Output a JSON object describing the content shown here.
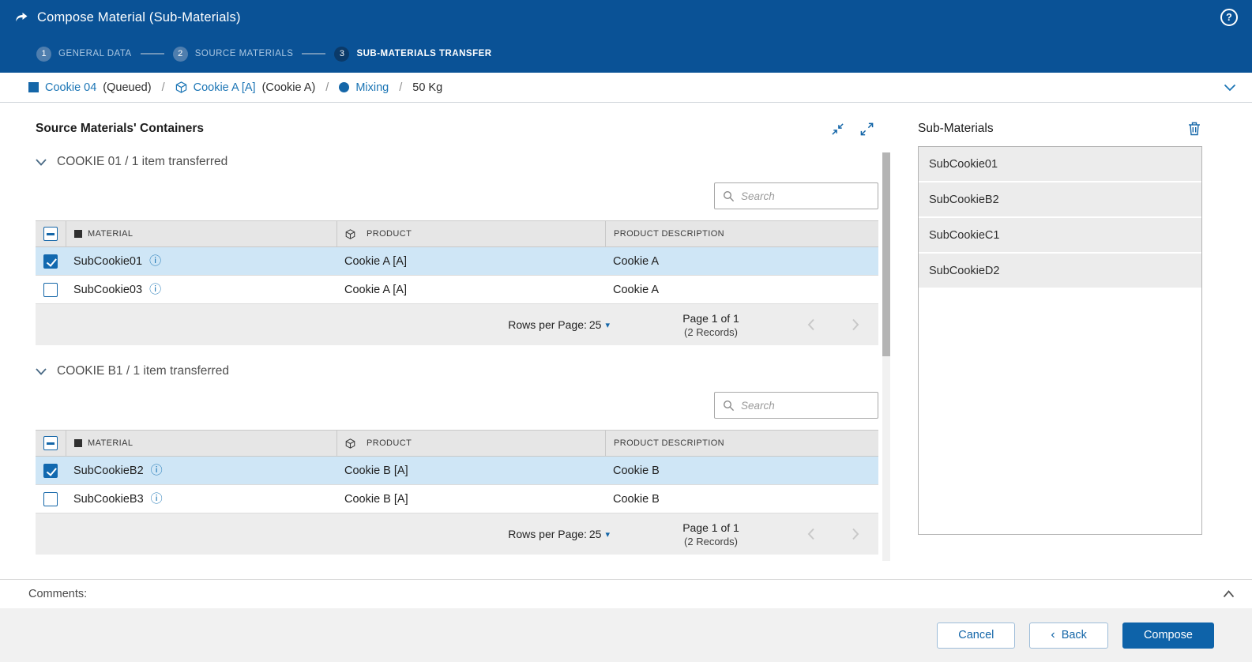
{
  "header": {
    "title": "Compose Material (Sub-Materials)"
  },
  "icons": {
    "help": "?",
    "info": "ⓘ",
    "caret_down": "▾",
    "back_chevron": "‹"
  },
  "stepper": {
    "steps": [
      {
        "number": "1",
        "label": "GENERAL DATA"
      },
      {
        "number": "2",
        "label": "SOURCE MATERIALS"
      },
      {
        "number": "3",
        "label": "SUB-MATERIALS TRANSFER"
      }
    ]
  },
  "breadcrumb": {
    "separator": "/",
    "material": "Cookie 04",
    "material_state": "(Queued)",
    "product": "Cookie A [A]",
    "product_name": "(Cookie A)",
    "flow_step": "Mixing",
    "quantity": "50 Kg"
  },
  "left_panel": {
    "title": "Source Materials' Containers",
    "sections": [
      {
        "title": "COOKIE 01 / 1 item transferred",
        "search_placeholder": "Search",
        "columns": {
          "material": "MATERIAL",
          "product": "PRODUCT",
          "description": "PRODUCT DESCRIPTION"
        },
        "rows": [
          {
            "material": "SubCookie01",
            "product": "Cookie A [A]",
            "description": "Cookie A",
            "checked": true
          },
          {
            "material": "SubCookie03",
            "product": "Cookie A [A]",
            "description": "Cookie A",
            "checked": false
          }
        ],
        "pagination": {
          "rows_per_page_label": "Rows per Page:",
          "rows_per_page_value": "25",
          "page_label": "Page 1 of 1",
          "records_label": "(2 Records)"
        }
      },
      {
        "title": "COOKIE B1 / 1 item transferred",
        "search_placeholder": "Search",
        "columns": {
          "material": "MATERIAL",
          "product": "PRODUCT",
          "description": "PRODUCT DESCRIPTION"
        },
        "rows": [
          {
            "material": "SubCookieB2",
            "product": "Cookie B [A]",
            "description": "Cookie B",
            "checked": true
          },
          {
            "material": "SubCookieB3",
            "product": "Cookie B [A]",
            "description": "Cookie B",
            "checked": false
          }
        ],
        "pagination": {
          "rows_per_page_label": "Rows per Page:",
          "rows_per_page_value": "25",
          "page_label": "Page 1 of 1",
          "records_label": "(2 Records)"
        }
      }
    ]
  },
  "right_panel": {
    "title": "Sub-Materials",
    "items": [
      "SubCookie01",
      "SubCookieB2",
      "SubCookieC1",
      "SubCookieD2"
    ]
  },
  "comments": {
    "label": "Comments:"
  },
  "footer": {
    "cancel": "Cancel",
    "back": "Back",
    "compose": "Compose"
  },
  "colors": {
    "header_bg": "#0a5296",
    "accent": "#1466a8",
    "link": "#1b75b5",
    "selected_row_bg": "#cfe6f6",
    "primary_button_bg": "#0e63a9"
  }
}
